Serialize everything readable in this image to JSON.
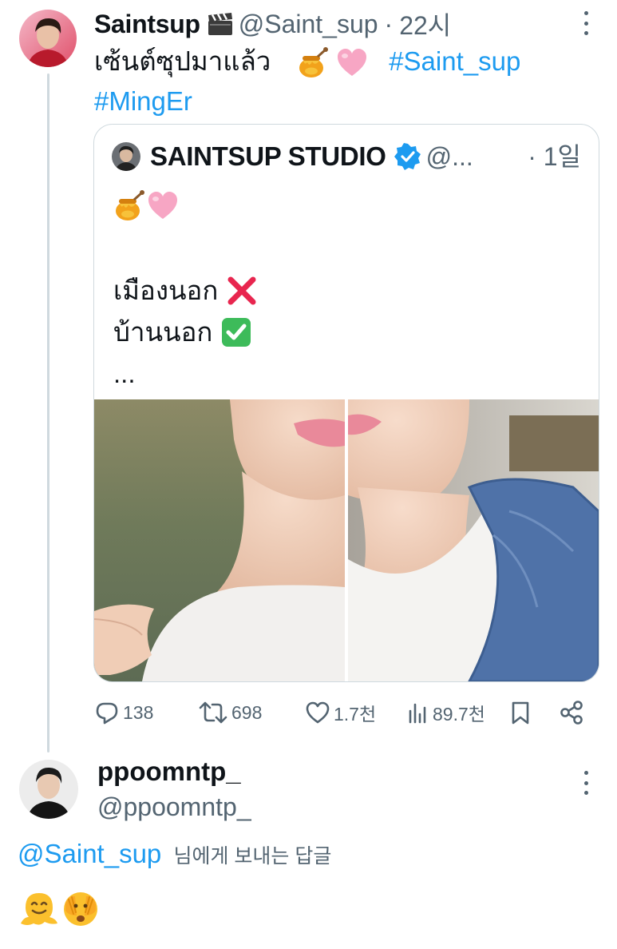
{
  "original_post": {
    "display_name": "Saintsup",
    "name_badge_icon": "clapper-board-icon",
    "handle": "@Saint_sup",
    "separator": "·",
    "time": "22시",
    "text": "เซ้นต์ซุปมาแล้ว",
    "text_emojis": [
      "honey-pot-icon",
      "pink-heart-icon"
    ],
    "hashtag_1": "#Saint_sup",
    "hashtag_2": "#MingEr"
  },
  "quoted_post": {
    "display_name": "SAINTSUP STUDIO",
    "verified": "verified-badge-icon",
    "handle": "@...",
    "separator": "·",
    "time": "1일",
    "emojis": [
      "honey-pot-icon",
      "pink-heart-icon"
    ],
    "line_1": "เมืองนอก",
    "line_1_mark": "red-cross-icon",
    "line_2": "บ้านนอก",
    "line_2_mark": "green-check-icon",
    "ellipsis": "...",
    "image": "split-photo-lips-and-neck"
  },
  "actions": {
    "replies": "138",
    "reposts": "698",
    "likes": "1.7천",
    "views": "89.7천"
  },
  "reply": {
    "display_name": "ppoomntp_",
    "handle": "@ppoomntp_",
    "mention": "@Saint_sup",
    "mention_suffix": "님에게 보내는 답글",
    "emojis": [
      "melting-face-icon",
      "face-with-peeking-eye-icon"
    ]
  },
  "colors": {
    "accent": "#1d9bf0",
    "secondary_text": "#536471",
    "border": "#cfd9de",
    "verified": "#1d9bf0"
  }
}
